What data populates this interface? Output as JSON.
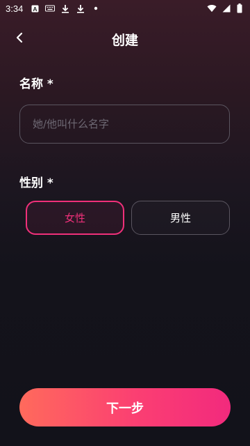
{
  "status_bar": {
    "time": "3:34",
    "left_icons": [
      "a-icon",
      "keyboard-icon",
      "download-icon",
      "download-icon",
      "dot-icon"
    ],
    "right_icons": [
      "wifi-icon",
      "signal-icon",
      "battery-icon"
    ]
  },
  "header": {
    "title": "创建",
    "back_icon": "chevron-left-icon"
  },
  "form": {
    "name_label": "名称 *",
    "name_value": "",
    "name_placeholder": "她/他叫什么名字",
    "gender_label": "性别 *",
    "gender_options": [
      {
        "label": "女性",
        "selected": true
      },
      {
        "label": "男性",
        "selected": false
      }
    ]
  },
  "footer": {
    "next_label": "下一步"
  },
  "colors": {
    "accent": "#f0307a",
    "button_gradient_start": "#ff6a5c",
    "button_gradient_end": "#f22a7d",
    "background_top": "#3a1c28",
    "background_bottom": "#12121a"
  }
}
